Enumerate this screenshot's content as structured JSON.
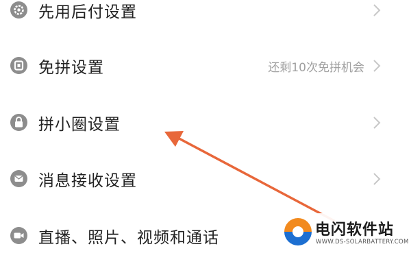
{
  "settings": {
    "items": [
      {
        "label": "先用后付设置",
        "icon": "gear-icon",
        "hint": ""
      },
      {
        "label": "免拼设置",
        "icon": "coupon-icon",
        "hint": "还剩10次免拼机会"
      },
      {
        "label": "拼小圈设置",
        "icon": "lock-icon",
        "hint": ""
      },
      {
        "label": "消息接收设置",
        "icon": "message-icon",
        "hint": ""
      },
      {
        "label": "直播、照片、视频和通话",
        "icon": "camera-icon",
        "hint": ""
      }
    ]
  },
  "annotation": {
    "arrow_color": "#e8673a"
  },
  "watermark": {
    "title": "电闪软件站",
    "url": "WWW.DS-SOLARBATTERY.COM"
  },
  "colors": {
    "icon_gray": "#8d8d8d",
    "chevron": "#c8c8c8",
    "hint_text": "#a0a0a0"
  }
}
